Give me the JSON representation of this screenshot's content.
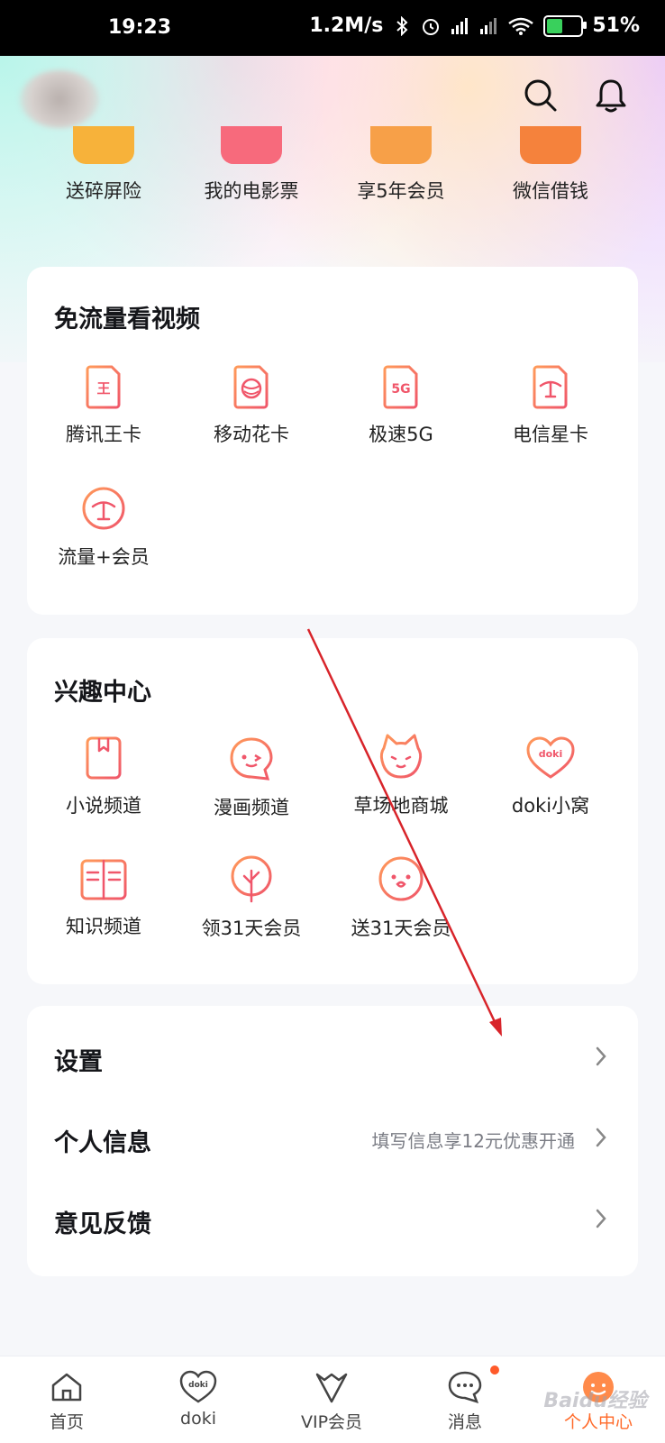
{
  "status_bar": {
    "time": "19:23",
    "speed": "1.2M/s",
    "battery": "51%",
    "battery_level": 0.51
  },
  "quick_actions": [
    {
      "label": "送碎屏险",
      "color": "#f7b23a"
    },
    {
      "label": "我的电影票",
      "color": "#f76a7c"
    },
    {
      "label": "享5年会员",
      "color": "#f7a048"
    },
    {
      "label": "微信借钱",
      "color": "#f5823c"
    }
  ],
  "free_data": {
    "title": "免流量看视频",
    "items": [
      {
        "label": "腾讯王卡",
        "icon": "sim-card-king-icon",
        "glyph": "王"
      },
      {
        "label": "移动花卡",
        "icon": "sim-card-mobile-icon",
        "glyph": ""
      },
      {
        "label": "极速5G",
        "icon": "sim-card-5g-icon",
        "glyph": "5G"
      },
      {
        "label": "电信星卡",
        "icon": "sim-card-telecom-icon",
        "glyph": ""
      },
      {
        "label": "流量+会员",
        "icon": "telecom-circle-icon",
        "glyph": ""
      }
    ]
  },
  "interest_center": {
    "title": "兴趣中心",
    "items": [
      {
        "label": "小说频道",
        "icon": "book-icon"
      },
      {
        "label": "漫画频道",
        "icon": "comic-face-icon"
      },
      {
        "label": "草场地商城",
        "icon": "cat-face-icon"
      },
      {
        "label": "doki小窝",
        "icon": "doki-heart-icon",
        "glyph": "doki"
      },
      {
        "label": "知识频道",
        "icon": "open-book-icon"
      },
      {
        "label": "领31天会员",
        "icon": "tree-icon"
      },
      {
        "label": "送31天会员",
        "icon": "ghost-face-icon"
      }
    ]
  },
  "settings_list": [
    {
      "label": "设置",
      "hint": ""
    },
    {
      "label": "个人信息",
      "hint": "填写信息享12元优惠开通"
    },
    {
      "label": "意见反馈",
      "hint": ""
    }
  ],
  "tabbar": {
    "tabs": [
      {
        "label": "首页",
        "icon": "home-icon"
      },
      {
        "label": "doki",
        "icon": "doki-heart-icon",
        "glyph": "doki"
      },
      {
        "label": "VIP会员",
        "icon": "vip-crown-icon"
      },
      {
        "label": "消息",
        "icon": "message-bubble-icon"
      },
      {
        "label": "个人中心",
        "icon": "profile-face-icon"
      }
    ],
    "active_index": 4,
    "accent": "#ff6a2a"
  },
  "watermark": "Baidu经验"
}
